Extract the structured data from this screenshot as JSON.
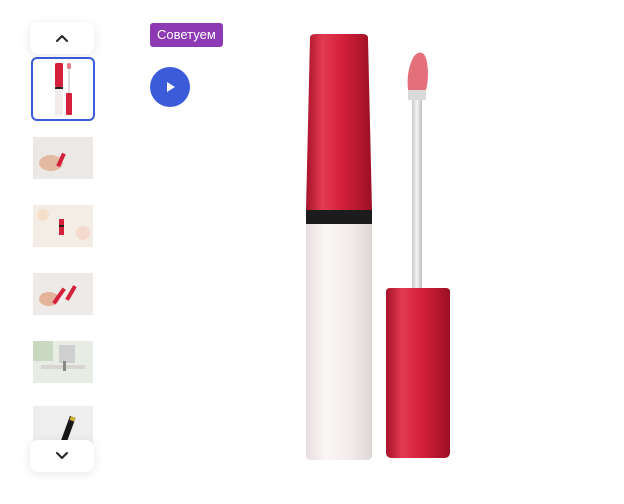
{
  "badge": {
    "label": "Советуем"
  },
  "gallery": {
    "active_index": 0,
    "thumbnails": [
      {
        "subject": "lip-gloss-product"
      },
      {
        "subject": "hand-holding-lipstick"
      },
      {
        "subject": "lipstick-on-table"
      },
      {
        "subject": "hand-with-lipsticks"
      },
      {
        "subject": "vanity-table"
      },
      {
        "subject": "black-lipstick"
      }
    ],
    "main_subject": "red-lip-gloss-with-applicator"
  },
  "colors": {
    "accent_blue": "#3b5bdb",
    "badge_purple": "#8e3ab5",
    "product_red": "#d4203a"
  },
  "icons": {
    "scroll_up": "chevron-up-icon",
    "scroll_down": "chevron-down-icon",
    "play": "play-icon"
  }
}
